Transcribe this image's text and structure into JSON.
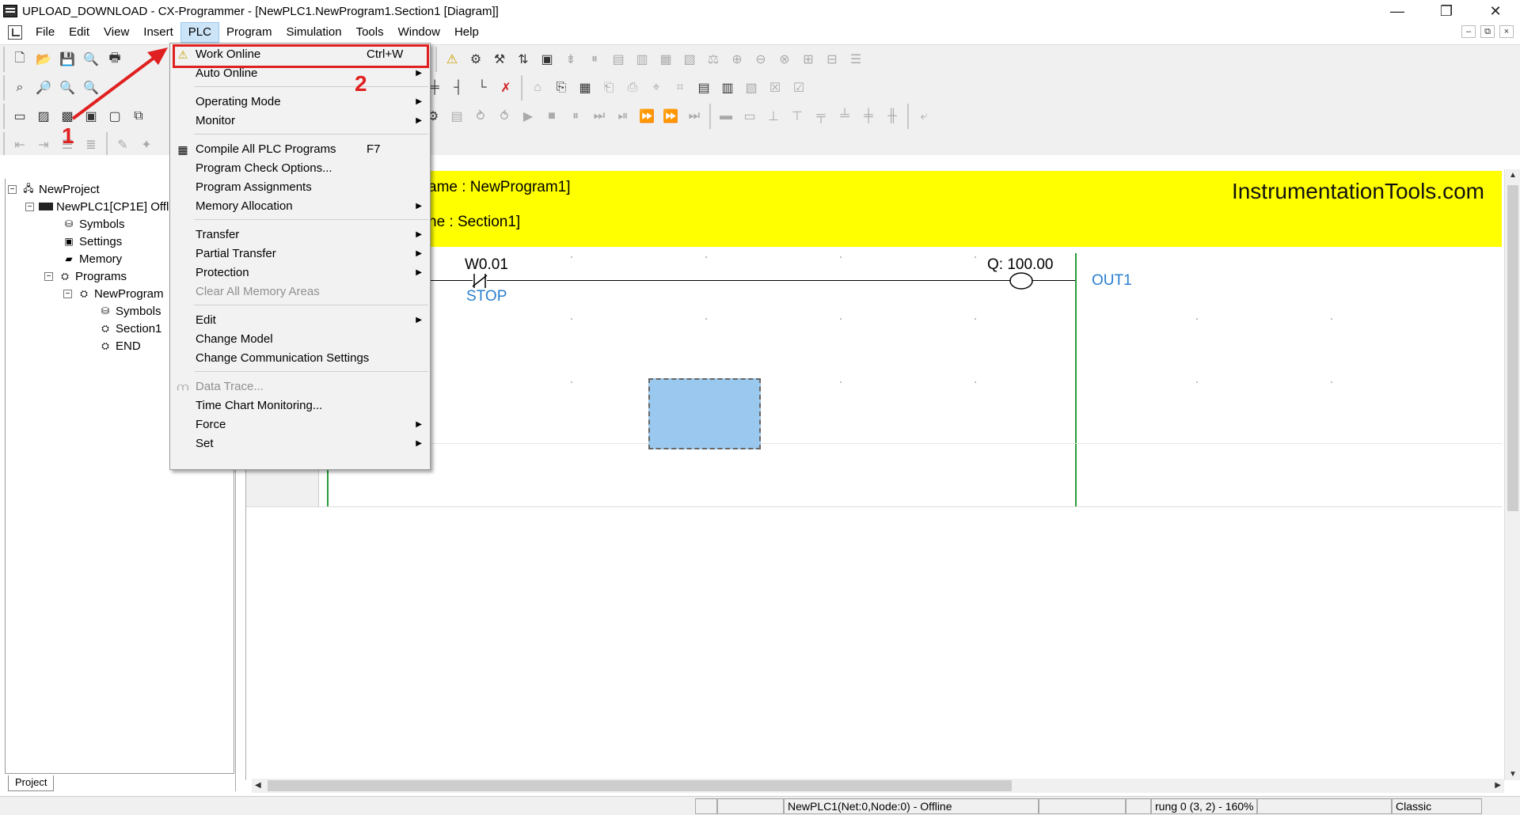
{
  "window": {
    "title": "UPLOAD_DOWNLOAD - CX-Programmer - [NewPLC1.NewProgram1.Section1 [Diagram]]",
    "controls": [
      "—",
      "❐",
      "✕"
    ],
    "mdi_controls": [
      "–",
      "⧉",
      "×"
    ]
  },
  "menubar": {
    "items": [
      "File",
      "Edit",
      "View",
      "Insert",
      "PLC",
      "Program",
      "Simulation",
      "Tools",
      "Window",
      "Help"
    ],
    "active": "PLC"
  },
  "plc_menu": {
    "items": [
      {
        "label": "Work Online",
        "shortcut": "Ctrl+W",
        "icon": "warning-icon",
        "highlighted": true
      },
      {
        "label": "Auto Online",
        "submenu": true
      },
      {
        "label": "Operating Mode",
        "submenu": true
      },
      {
        "label": "Monitor",
        "submenu": true
      },
      {
        "label": "Compile All PLC Programs",
        "shortcut": "F7",
        "icon": "compile-icon"
      },
      {
        "label": "Program Check Options..."
      },
      {
        "label": "Program Assignments"
      },
      {
        "label": "Memory Allocation",
        "submenu": true
      },
      {
        "label": "Transfer",
        "submenu": true
      },
      {
        "label": "Partial Transfer",
        "submenu": true
      },
      {
        "label": "Protection",
        "submenu": true
      },
      {
        "label": "Clear All Memory Areas",
        "disabled": true
      },
      {
        "label": "Edit",
        "submenu": true
      },
      {
        "label": "Change Model"
      },
      {
        "label": "Change Communication Settings"
      },
      {
        "label": "Data Trace...",
        "disabled": true,
        "icon": "data-trace-icon"
      },
      {
        "label": "Time Chart Monitoring..."
      },
      {
        "label": "Force",
        "submenu": true
      },
      {
        "label": "Set",
        "submenu": true
      }
    ]
  },
  "project_tree": {
    "items": [
      {
        "label": "NewProject",
        "level": 0,
        "icon": "project-icon"
      },
      {
        "label": "NewPLC1[CP1E] Offl",
        "level": 1,
        "icon": "plc-icon"
      },
      {
        "label": "Symbols",
        "level": 2,
        "icon": "symbols-icon"
      },
      {
        "label": "Settings",
        "level": 2,
        "icon": "settings-icon"
      },
      {
        "label": "Memory",
        "level": 2,
        "icon": "memory-icon"
      },
      {
        "label": "Programs",
        "level": 2,
        "icon": "programs-icon"
      },
      {
        "label": "NewProgram",
        "level": 3,
        "icon": "program-icon"
      },
      {
        "label": "Symbols",
        "level": 4,
        "icon": "symbols-icon"
      },
      {
        "label": "Section1",
        "level": 4,
        "icon": "section-icon"
      },
      {
        "label": "END",
        "level": 4,
        "icon": "section-icon"
      }
    ],
    "tab_label": "Project"
  },
  "diagram": {
    "banner_line1": "ame : NewProgram1]",
    "banner_line2": "ne : Section1]",
    "brand": "InstrumentationTools.com",
    "contact_address": "W0.01",
    "contact_symbol": "STOP",
    "coil_address": "Q: 100.00",
    "coil_symbol": "OUT1"
  },
  "statusbar": {
    "connection": "NewPLC1(Net:0,Node:0) - Offline",
    "position": "rung 0 (3, 2)  - 160%",
    "mode": "Classic"
  },
  "annotations": {
    "step1": "1",
    "step2": "2",
    "color": "#e02020"
  }
}
